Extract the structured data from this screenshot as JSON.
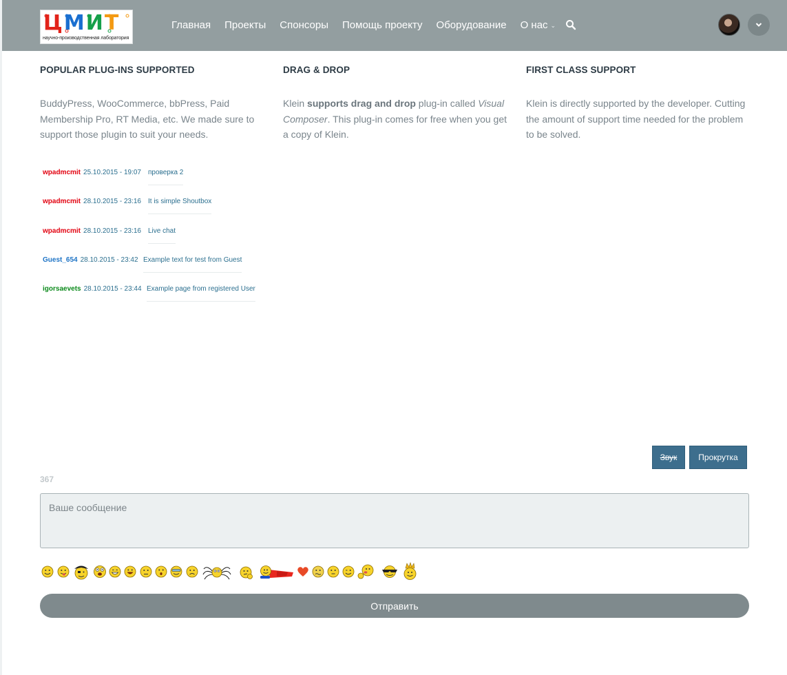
{
  "header": {
    "logo": {
      "text": "ЦМИТ",
      "subtitle": "научно-производственная лаборатория"
    },
    "nav": [
      "Главная",
      "Проекты",
      "Спонсоры",
      "Помощь проекту",
      "Оборудование",
      "О нас"
    ],
    "icons": {
      "search": "search-icon",
      "dropdown": "chevron-down-icon",
      "user_menu": "chevron-down-icon"
    }
  },
  "features": [
    {
      "title": "POPULAR PLUG-INS SUPPORTED",
      "text": "BuddyPress, WooCommerce, bbPress, Paid Membership Pro, RT Media, etc. We made sure to support those plugin to suit your needs."
    },
    {
      "title": "DRAG & DROP",
      "text_prefix": "Klein ",
      "text_bold": "supports drag and drop",
      "text_mid": " plug-in called ",
      "text_italic": "Visual Composer",
      "text_suffix": ". This plug-in comes for free when you get a copy of Klein."
    },
    {
      "title": "FIRST CLASS SUPPORT",
      "text": "Klein is directly supported by the developer. Cutting the amount of support time needed for the problem to be solved."
    }
  ],
  "shoutbox": {
    "messages": [
      {
        "user": "wpadmcmit",
        "time": "25.10.2015 - 19:07",
        "text": "проверка 2",
        "role": "admin"
      },
      {
        "user": "wpadmcmit",
        "time": "28.10.2015 - 23:16",
        "text": "It is simple Shoutbox",
        "role": "admin"
      },
      {
        "user": "wpadmcmit",
        "time": "28.10.2015 - 23:16",
        "text": "Live chat",
        "role": "admin"
      },
      {
        "user": "Guest_654",
        "time": "28.10.2015 - 23:42",
        "text": "Example text for test from Guest",
        "role": "guest"
      },
      {
        "user": "igorsaevets",
        "time": "28.10.2015 - 23:44",
        "text": "Example page from registered User",
        "role": "registered"
      }
    ],
    "sound_button": "Звук",
    "scroll_button": "Прокрутка",
    "char_count": "367",
    "input_placeholder": "Ваше сообщение",
    "send_button": "Отправить",
    "smileys": [
      "smile",
      "tongue",
      "pirate",
      "shocked",
      "grin",
      "laugh",
      "worried",
      "surprised",
      "cool",
      "sad",
      "spider",
      "thinking",
      "superman",
      "heart",
      "sick",
      "neutral",
      "wink",
      "kiss",
      "sunglasses",
      "king"
    ],
    "colors": {
      "admin": "#e2000f",
      "guest": "#1e74c6",
      "registered": "#0b8a1b",
      "button": "#3d6e8d"
    }
  }
}
